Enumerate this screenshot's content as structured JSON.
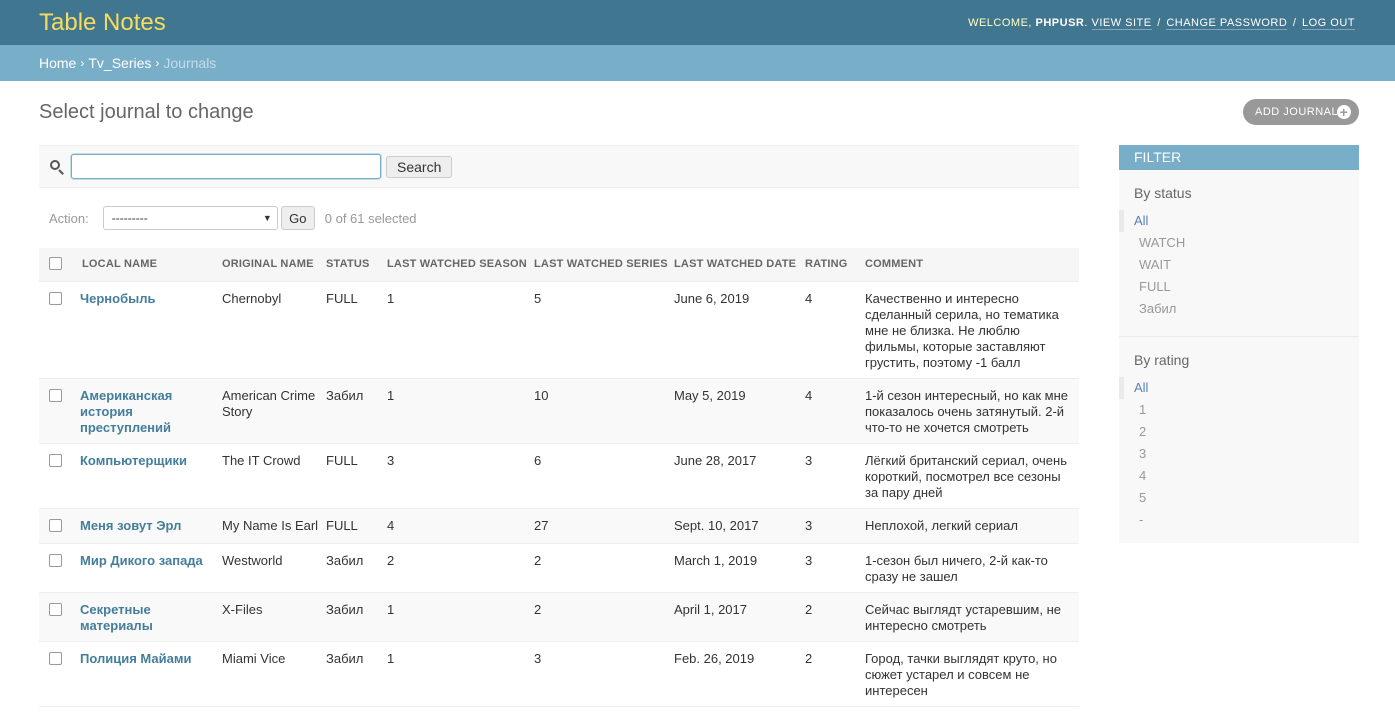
{
  "header": {
    "brand": "Table Notes",
    "welcome": "Welcome,",
    "username": "PHPUSR",
    "view_site": "View site",
    "change_password": "Change password",
    "log_out": "Log out"
  },
  "breadcrumbs": {
    "home": "Home",
    "app": "Tv_Series",
    "current": "Journals",
    "separator": "›"
  },
  "page": {
    "title": "Select journal to change",
    "add_button": "Add journal"
  },
  "search": {
    "value": "",
    "button": "Search"
  },
  "actions": {
    "label": "Action:",
    "selected_option": "---------",
    "go": "Go",
    "selected_count": "0 of 61 selected"
  },
  "table": {
    "columns": [
      "Local name",
      "Original name",
      "Status",
      "Last watched season",
      "Last watched series",
      "Last watched date",
      "Rating",
      "Comment"
    ],
    "rows": [
      {
        "local": "Чернобыль",
        "original": "Chernobyl",
        "status": "FULL",
        "season": "1",
        "series": "5",
        "date": "June 6, 2019",
        "rating": "4",
        "comment": "Качественно и интересно сделанный серила, но тематика мне не близка. Не люблю фильмы, которые заставляют грустить, поэтому -1 балл"
      },
      {
        "local": "Американская история преступлений",
        "original": "American Crime Story",
        "status": "Забил",
        "season": "1",
        "series": "10",
        "date": "May 5, 2019",
        "rating": "4",
        "comment": "1-й сезон интересный, но как мне показалось очень затянутый. 2-й что-то не хочется смотреть"
      },
      {
        "local": "Компьютерщики",
        "original": "The IT Crowd",
        "status": "FULL",
        "season": "3",
        "series": "6",
        "date": "June 28, 2017",
        "rating": "3",
        "comment": "Лёгкий британский сериал, очень короткий, посмотрел все сезоны за пару дней"
      },
      {
        "local": "Меня зовут Эрл",
        "original": "My Name Is Earl",
        "status": "FULL",
        "season": "4",
        "series": "27",
        "date": "Sept. 10, 2017",
        "rating": "3",
        "comment": "Неплохой, легкий сериал"
      },
      {
        "local": "Мир Дикого запада",
        "original": "Westworld",
        "status": "Забил",
        "season": "2",
        "series": "2",
        "date": "March 1, 2019",
        "rating": "3",
        "comment": "1-сезон был ничего, 2-й как-то сразу не зашел"
      },
      {
        "local": "Секретные материалы",
        "original": "X-Files",
        "status": "Забил",
        "season": "1",
        "series": "2",
        "date": "April 1, 2017",
        "rating": "2",
        "comment": "Сейчас выглядт устаревшим, не интересно смотреть"
      },
      {
        "local": "Полиция Майами",
        "original": "Miami Vice",
        "status": "Забил",
        "season": "1",
        "series": "3",
        "date": "Feb. 26, 2019",
        "rating": "2",
        "comment": "Город, тачки выглядят круто, но сюжет устарел и совсем не интересен"
      }
    ]
  },
  "filter": {
    "title": "Filter",
    "by_status": {
      "title": "By status",
      "options": [
        "All",
        "WATCH",
        "WAIT",
        "FULL",
        "Забил"
      ],
      "selected": "All"
    },
    "by_rating": {
      "title": "By rating",
      "options": [
        "All",
        "1",
        "2",
        "3",
        "4",
        "5",
        "-"
      ],
      "selected": "All"
    }
  },
  "colors": {
    "header_bg": "#417690",
    "brand": "#f5dd5d",
    "breadcrumbs_bg": "#79aec8",
    "link": "#447e9b",
    "filter_selected": "#5b80b2"
  },
  "icons": {
    "search": "search-icon",
    "add": "plus-icon",
    "select_arrow": "chevron-down-icon"
  }
}
